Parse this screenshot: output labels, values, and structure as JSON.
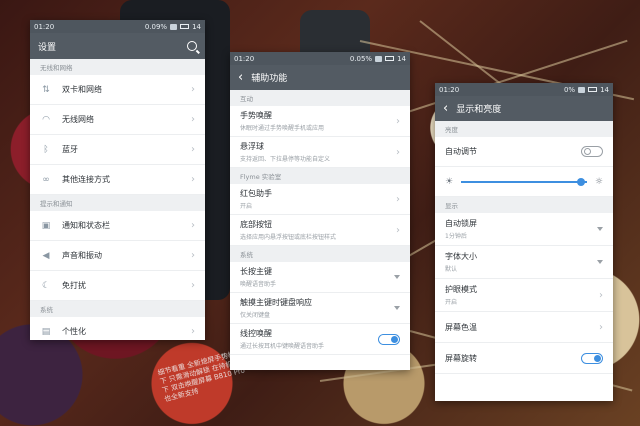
{
  "screens": {
    "settings": {
      "status": {
        "time": "01:20",
        "speed": "0.09%",
        "battery": "14"
      },
      "title": "设置",
      "sections": [
        {
          "header": "无线和网络",
          "items": [
            {
              "label": "双卡和网络",
              "icon": "arrows-updown-icon"
            },
            {
              "label": "无线网络",
              "icon": "wifi-icon"
            },
            {
              "label": "蓝牙",
              "icon": "bluetooth-icon"
            },
            {
              "label": "其他连接方式",
              "icon": "link-icon"
            }
          ]
        },
        {
          "header": "提示和通知",
          "items": [
            {
              "label": "通知和状态栏",
              "icon": "notification-icon"
            },
            {
              "label": "声音和振动",
              "icon": "speaker-icon"
            },
            {
              "label": "免打扰",
              "icon": "moon-icon"
            }
          ]
        },
        {
          "header": "系统",
          "items": [
            {
              "label": "个性化",
              "icon": "personalize-icon"
            }
          ]
        }
      ]
    },
    "accessibility": {
      "status": {
        "time": "01:20",
        "speed": "0.05%",
        "battery": "14"
      },
      "title": "辅助功能",
      "sections": [
        {
          "header": "互动",
          "items": [
            {
              "label": "手势唤醒",
              "sub": "休眠时通过手势唤醒手机或应用",
              "control": "chevron"
            },
            {
              "label": "悬浮球",
              "sub": "支持返回、下拉悬停等功能自定义",
              "control": "chevron"
            }
          ]
        },
        {
          "header": "Flyme 实验室",
          "items": [
            {
              "label": "红包助手",
              "sub": "开启",
              "control": "chevron"
            },
            {
              "label": "底部按钮",
              "sub": "选择应用内悬浮按钮或底栏按钮样式",
              "control": "chevron"
            }
          ]
        },
        {
          "header": "系统",
          "items": [
            {
              "label": "长按主键",
              "sub": "唤醒语音助手",
              "control": "dropdown"
            },
            {
              "label": "触摸主键时键盘响应",
              "sub": "仅关闭键盘",
              "control": "dropdown"
            },
            {
              "label": "线控唤醒",
              "sub": "通过长按耳机中键唤醒语音助手",
              "control": "toggle",
              "value": true
            }
          ]
        }
      ]
    },
    "display": {
      "status": {
        "time": "01:20",
        "speed": "0%",
        "battery": "14"
      },
      "title": "显示和亮度",
      "brightness_header": "亮度",
      "auto_adjust": {
        "label": "自动调节",
        "value": false
      },
      "brightness_level": 0.95,
      "display_header": "显示",
      "items": [
        {
          "label": "自动锁屏",
          "sub": "1分钟后",
          "control": "dropdown"
        },
        {
          "label": "字体大小",
          "sub": "默认",
          "control": "dropdown"
        },
        {
          "label": "护眼模式",
          "sub": "开启",
          "control": "chevron"
        },
        {
          "label": "屏幕色温",
          "control": "chevron"
        },
        {
          "label": "屏幕旋转",
          "control": "toggle",
          "value": true
        }
      ]
    }
  },
  "background_caption": "细节看重 全新熄屏手势模式下 只需滑动解锁 在待机状态下 双击唤醒屏幕 B810 Pro 也全新支持"
}
